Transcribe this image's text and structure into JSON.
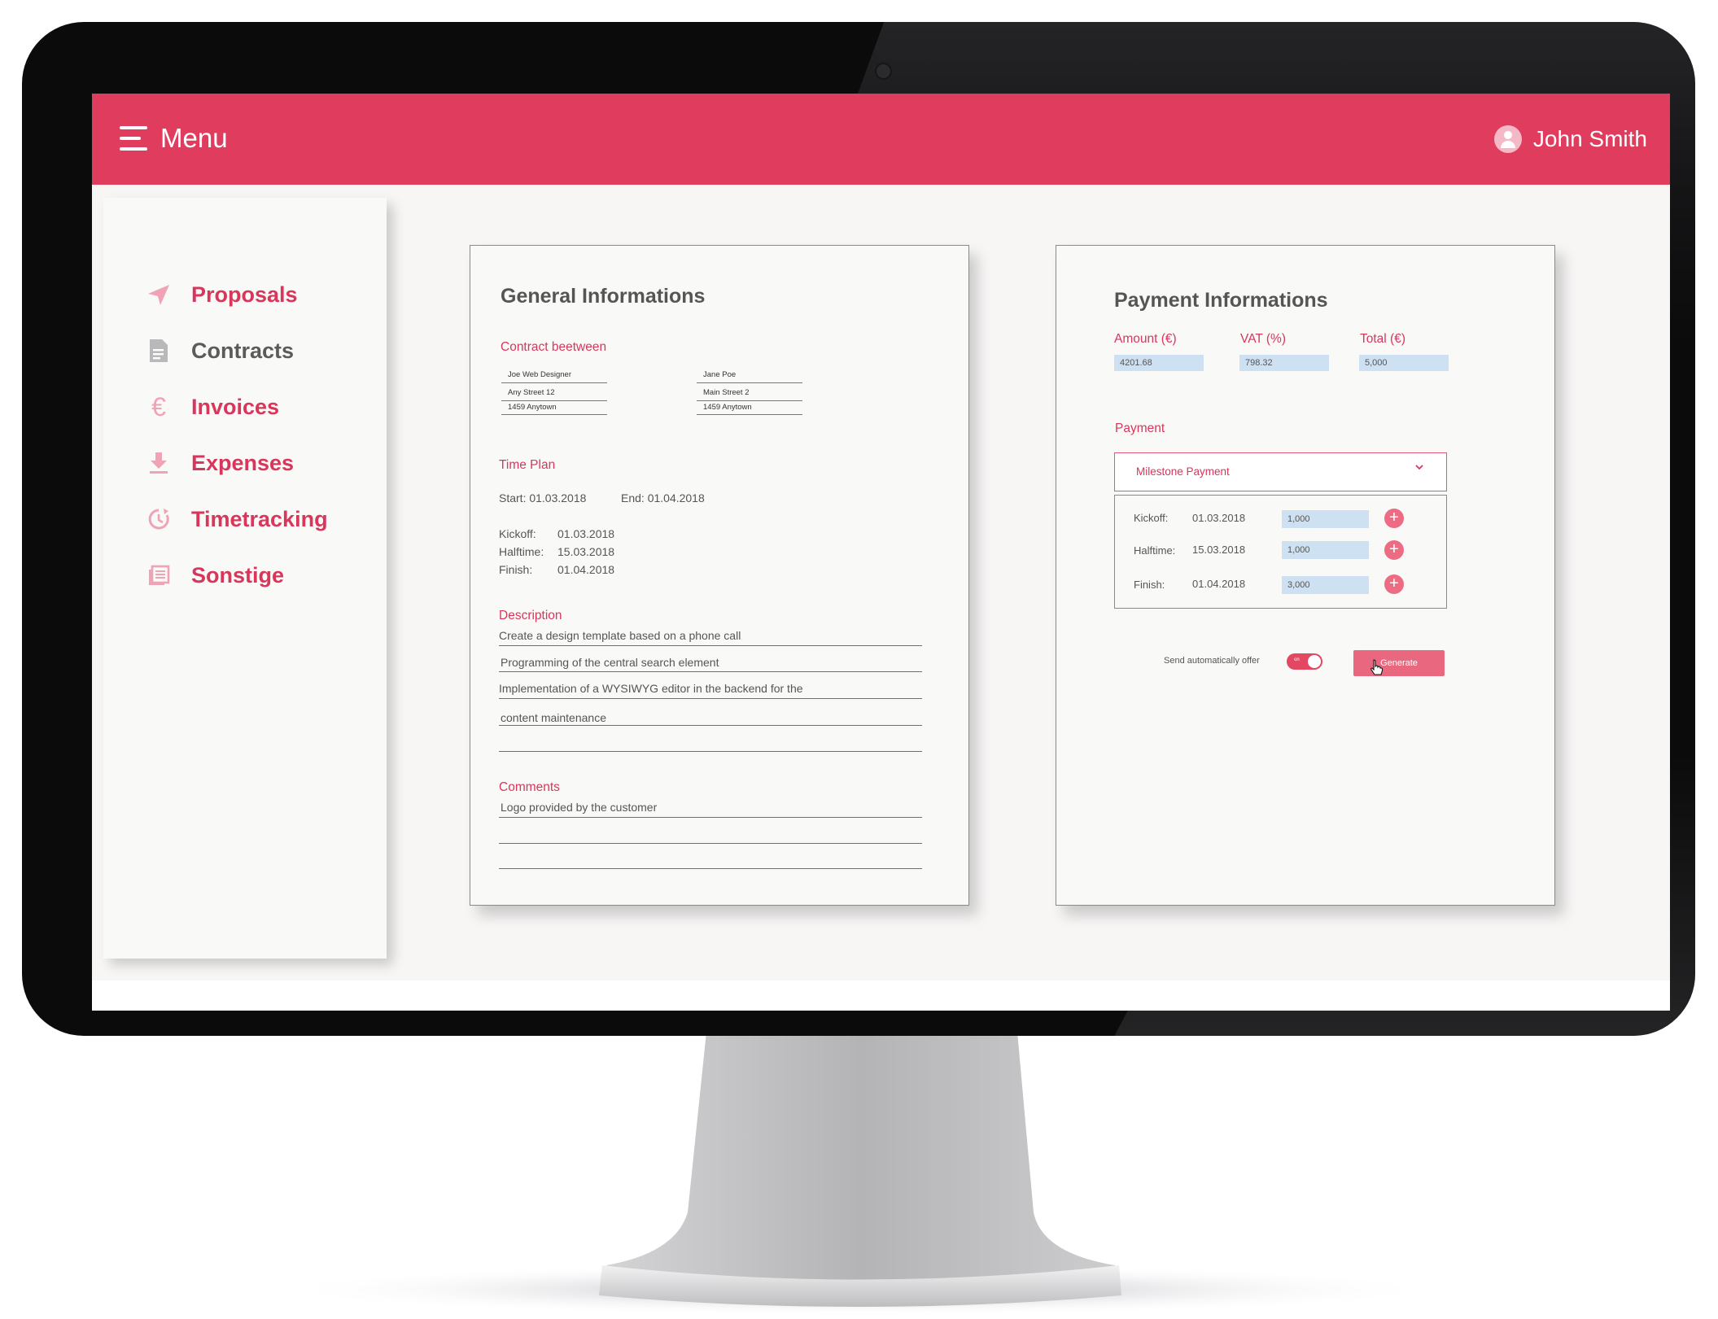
{
  "header": {
    "menu_label": "Menu",
    "user_name": "John Smith"
  },
  "sidebar": {
    "items": [
      {
        "label": "Proposals",
        "icon": "paper-plane-icon"
      },
      {
        "label": "Contracts",
        "icon": "document-icon"
      },
      {
        "label": "Invoices",
        "icon": "euro-icon"
      },
      {
        "label": "Expenses",
        "icon": "download-icon"
      },
      {
        "label": "Timetracking",
        "icon": "clock-icon"
      },
      {
        "label": "Sonstige",
        "icon": "list-icon"
      }
    ]
  },
  "general": {
    "title": "General Informations",
    "contract_label": "Contract beetween",
    "party_a": [
      "Joe Web Designer",
      "Any Street 12",
      "1459 Anytown"
    ],
    "party_b": [
      "Jane Poe",
      "Main Street 2",
      "1459 Anytown"
    ],
    "timeplan_label": "Time Plan",
    "start": "Start: 01.03.2018",
    "end": "End: 01.04.2018",
    "milestones": [
      {
        "label": "Kickoff:",
        "date": "01.03.2018"
      },
      {
        "label": "Halftime:",
        "date": "15.03.2018"
      },
      {
        "label": "Finish:",
        "date": "01.04.2018"
      }
    ],
    "description_label": "Description",
    "description_lines": [
      "Create a design template based on a phone call",
      "Programming of the central search element",
      "Implementation of a WYSIWYG editor in the backend for the",
      "content maintenance"
    ],
    "comments_label": "Comments",
    "comments_lines": [
      "Logo provided by the customer"
    ]
  },
  "payment": {
    "title": "Payment Informations",
    "amount_label": "Amount (€)",
    "amount_value": "4201.68",
    "vat_label": "VAT (%)",
    "vat_value": "798.32",
    "total_label": "Total (€)",
    "total_value": "5,000",
    "payment_label": "Payment",
    "payment_type": "Milestone Payment",
    "milestones": [
      {
        "label": "Kickoff:",
        "date": "01.03.2018",
        "amount": "1,000"
      },
      {
        "label": "Halftime:",
        "date": "15.03.2018",
        "amount": "1,000"
      },
      {
        "label": "Finish:",
        "date": "01.04.2018",
        "amount": "3,000"
      }
    ],
    "send_auto_label": "Send automatically offer",
    "toggle_text": "on",
    "toggle_on": true,
    "generate_label": "Generate"
  },
  "colors": {
    "accent": "#e03c5e",
    "field_bg": "#cde1f2"
  }
}
